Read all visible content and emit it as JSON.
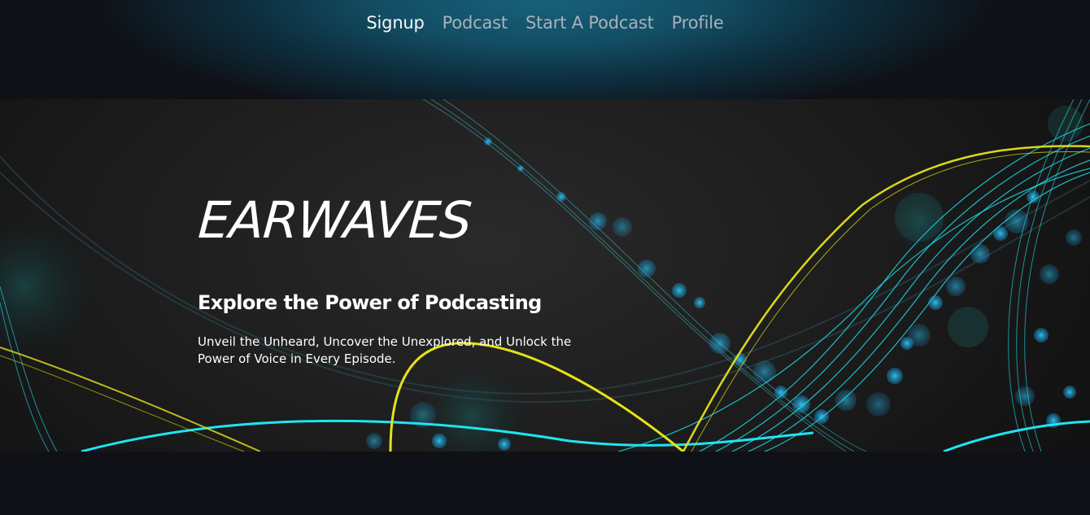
{
  "nav": {
    "items": [
      {
        "label": "Signup",
        "active": true
      },
      {
        "label": "Podcast",
        "active": false
      },
      {
        "label": "Start A Podcast",
        "active": false
      },
      {
        "label": "Profile",
        "active": false
      }
    ]
  },
  "hero": {
    "brand": "EARWAVES",
    "tagline": "Explore the Power of Podcasting",
    "description": "Unveil the Unheard, Uncover the Unexplored, and Unlock the Power of Voice in Every Episode."
  },
  "colors": {
    "nav_active": "#f4f7f9",
    "nav_inactive": "#a7b2bb",
    "wave_cyan": "#1fe4f2",
    "wave_yellow": "#e6e21a",
    "background": "#0f1116"
  }
}
